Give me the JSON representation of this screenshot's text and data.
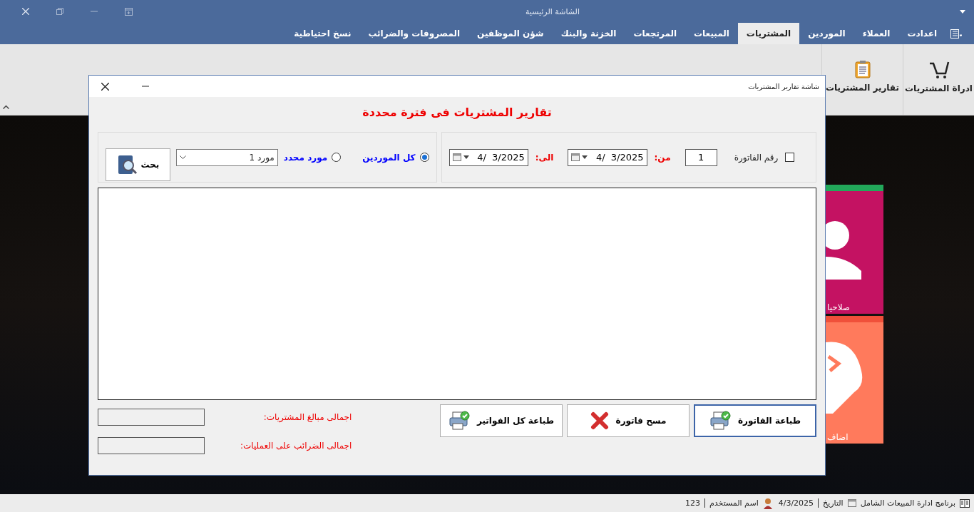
{
  "main_window": {
    "title": "الشاشة الرئيسية"
  },
  "menu_tabs": [
    {
      "label": "اعدادت",
      "selected": false
    },
    {
      "label": "العملاء",
      "selected": false
    },
    {
      "label": "الموردين",
      "selected": false
    },
    {
      "label": "المشتريات",
      "selected": true
    },
    {
      "label": "المبيعات",
      "selected": false
    },
    {
      "label": "المرتجعات",
      "selected": false
    },
    {
      "label": "الخزنة والبنك",
      "selected": false
    },
    {
      "label": "شؤن الموظفين",
      "selected": false
    },
    {
      "label": "المصروفات والضرائب",
      "selected": false
    },
    {
      "label": "نسخ احتياطية",
      "selected": false
    }
  ],
  "ribbon": [
    {
      "label": "ادراة المشتريات",
      "kind": "cart"
    },
    {
      "label": "تقارير المشتريات",
      "kind": "clipboard"
    }
  ],
  "tiles": [
    {
      "label": "صلاحيا",
      "kind": "user",
      "color": "#c41262"
    },
    {
      "label": "اضاف",
      "kind": "tag",
      "color": "#ff7a5c"
    }
  ],
  "dialog": {
    "title": "شاشة تقارير المشتريات",
    "heading": "تقارير المشتريات فى فترة محددة",
    "supplier_options": [
      {
        "label": "كل الموردين",
        "selected": true
      },
      {
        "label": "مورد محدد",
        "selected": false
      }
    ],
    "supplier_combo": {
      "value": "مورد 1"
    },
    "search_button": "بحث",
    "invoice_filter": {
      "label": "رقم الفاتورة",
      "checked": false,
      "value": "1"
    },
    "from_label": "من:",
    "from_date": "4/  3/2025",
    "to_label": "الى:",
    "to_date": "4/  3/2025",
    "actions": [
      {
        "label": "طباعة الفاتورة",
        "kind": "print",
        "selected": true
      },
      {
        "label": "مسح فاتورة",
        "kind": "delete",
        "selected": false
      },
      {
        "label": "طباعة كل الفواتير",
        "kind": "print",
        "selected": false
      }
    ],
    "totals": [
      "اجمالى مبالغ المشتريات:",
      "اجمالى الضرائب على العمليات:"
    ]
  },
  "status_bar": {
    "app_name": "برنامج ادارة المبيعات الشامل",
    "date_label": "التاريخ",
    "date": "4/3/2025",
    "user_label": "اسم المستخدم",
    "user": "123"
  }
}
